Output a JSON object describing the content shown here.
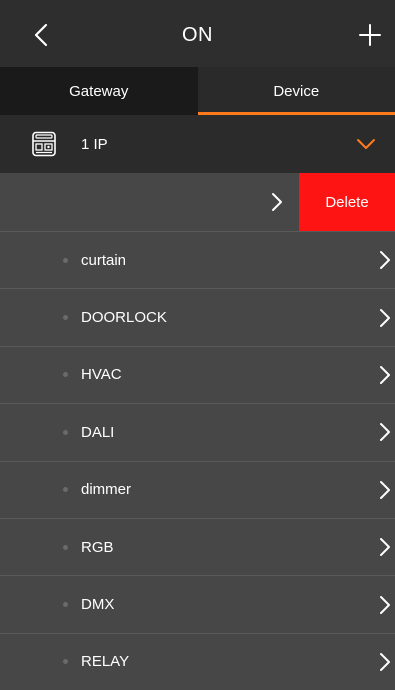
{
  "header": {
    "title": "ON",
    "back_icon": "chevron-left-icon",
    "add_icon": "plus-icon"
  },
  "tabs": [
    {
      "label": "Gateway",
      "active": false
    },
    {
      "label": "Device",
      "active": true
    }
  ],
  "colors": {
    "accent": "#ff7a1a",
    "delete": "#ff1414",
    "background": "#474747",
    "header": "#2e2e2e"
  },
  "group": {
    "icon": "gateway-device-icon",
    "label": "1 IP",
    "expand_icon": "chevron-down-icon"
  },
  "swiped_row": {
    "delete_label": "Delete",
    "arrow_icon": "chevron-right-icon"
  },
  "devices": [
    {
      "name": "curtain"
    },
    {
      "name": "DOORLOCK"
    },
    {
      "name": "HVAC"
    },
    {
      "name": "DALI"
    },
    {
      "name": "dimmer"
    },
    {
      "name": "RGB"
    },
    {
      "name": "DMX"
    },
    {
      "name": "RELAY"
    }
  ]
}
